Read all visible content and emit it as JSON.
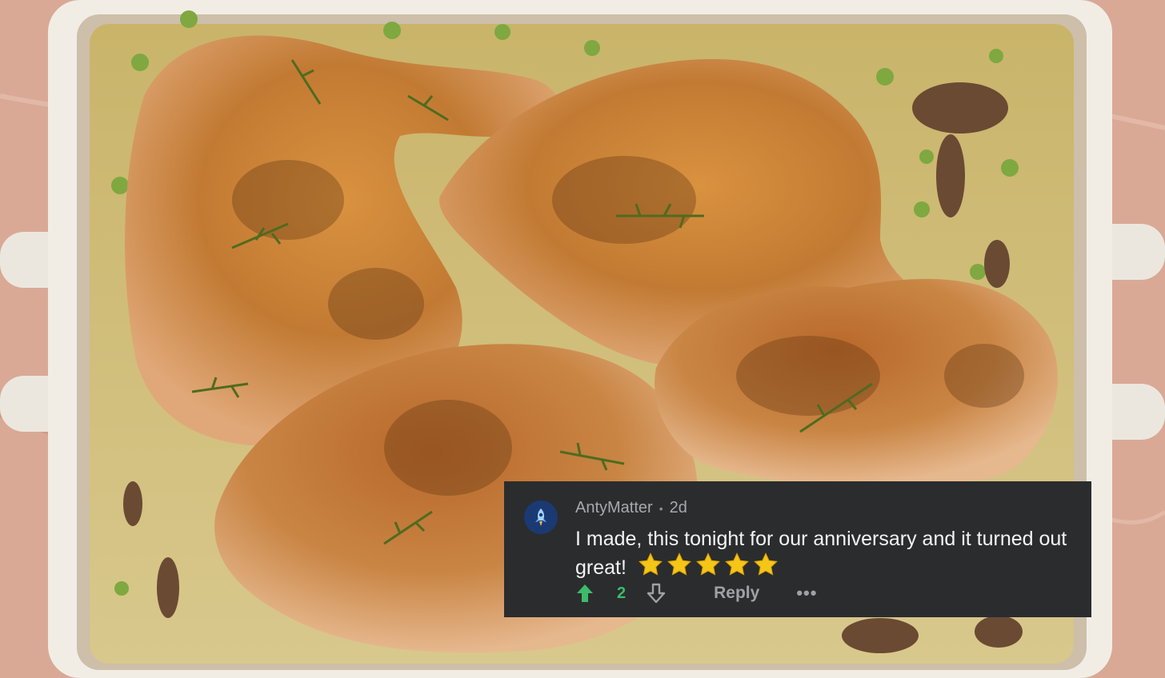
{
  "photo": {
    "colors": {
      "countertop": "#d9a996",
      "dish": "#f1ede5",
      "sauce": "#cdb872",
      "chicken_skin": "#c9803a",
      "peas": "#7fa840"
    }
  },
  "comment": {
    "username": "AntyMatter",
    "separator": "•",
    "age": "2d",
    "text": "I made, this tonight for our anniversary and it turned out great!",
    "stars_count": 5,
    "vote_count": "2",
    "reply_label": "Reply",
    "more_label": "•••",
    "icons": {
      "avatar": "rocket-icon",
      "upvote": "arrow-up-icon",
      "downvote": "arrow-down-icon",
      "star": "star-icon"
    },
    "colors": {
      "card_bg": "#2b2c2e",
      "upvote_active": "#3cbb6a",
      "muted_text": "#a6a9ad",
      "star": "#f5c518"
    }
  }
}
